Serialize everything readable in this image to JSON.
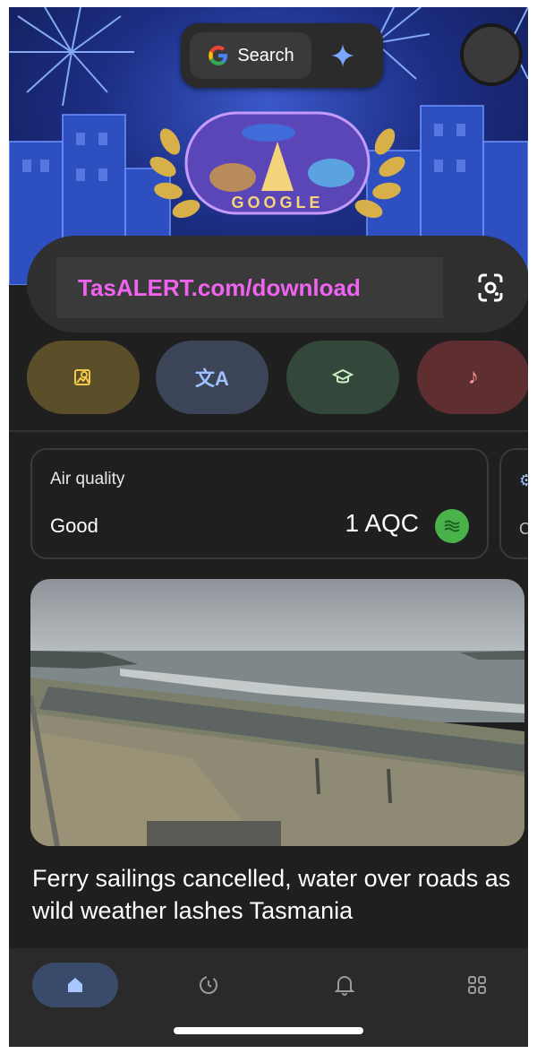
{
  "header": {
    "search_label": "Search",
    "doodle_text": "GOOGLE"
  },
  "search_bar": {
    "value": "TasALERT.com/download"
  },
  "chips": [
    {
      "icon": "image-search-icon",
      "color": "#5b4f2a"
    },
    {
      "icon": "translate-icon",
      "color": "#3b4557"
    },
    {
      "icon": "homework-cap-icon",
      "color": "#33473a"
    },
    {
      "icon": "music-note-icon",
      "color": "#5e2e30"
    }
  ],
  "air_quality": {
    "title": "Air quality",
    "status": "Good",
    "value": "1 AQC",
    "badge_color": "#49b34a"
  },
  "next_card": {
    "text": "Cu"
  },
  "news": {
    "headline": "Ferry sailings cancelled, water over roads as wild weather lashes Tasmania"
  },
  "nav": {
    "items": [
      "home-icon",
      "activity-icon",
      "notifications-icon",
      "apps-icon"
    ],
    "active_color": "#394a6a"
  }
}
